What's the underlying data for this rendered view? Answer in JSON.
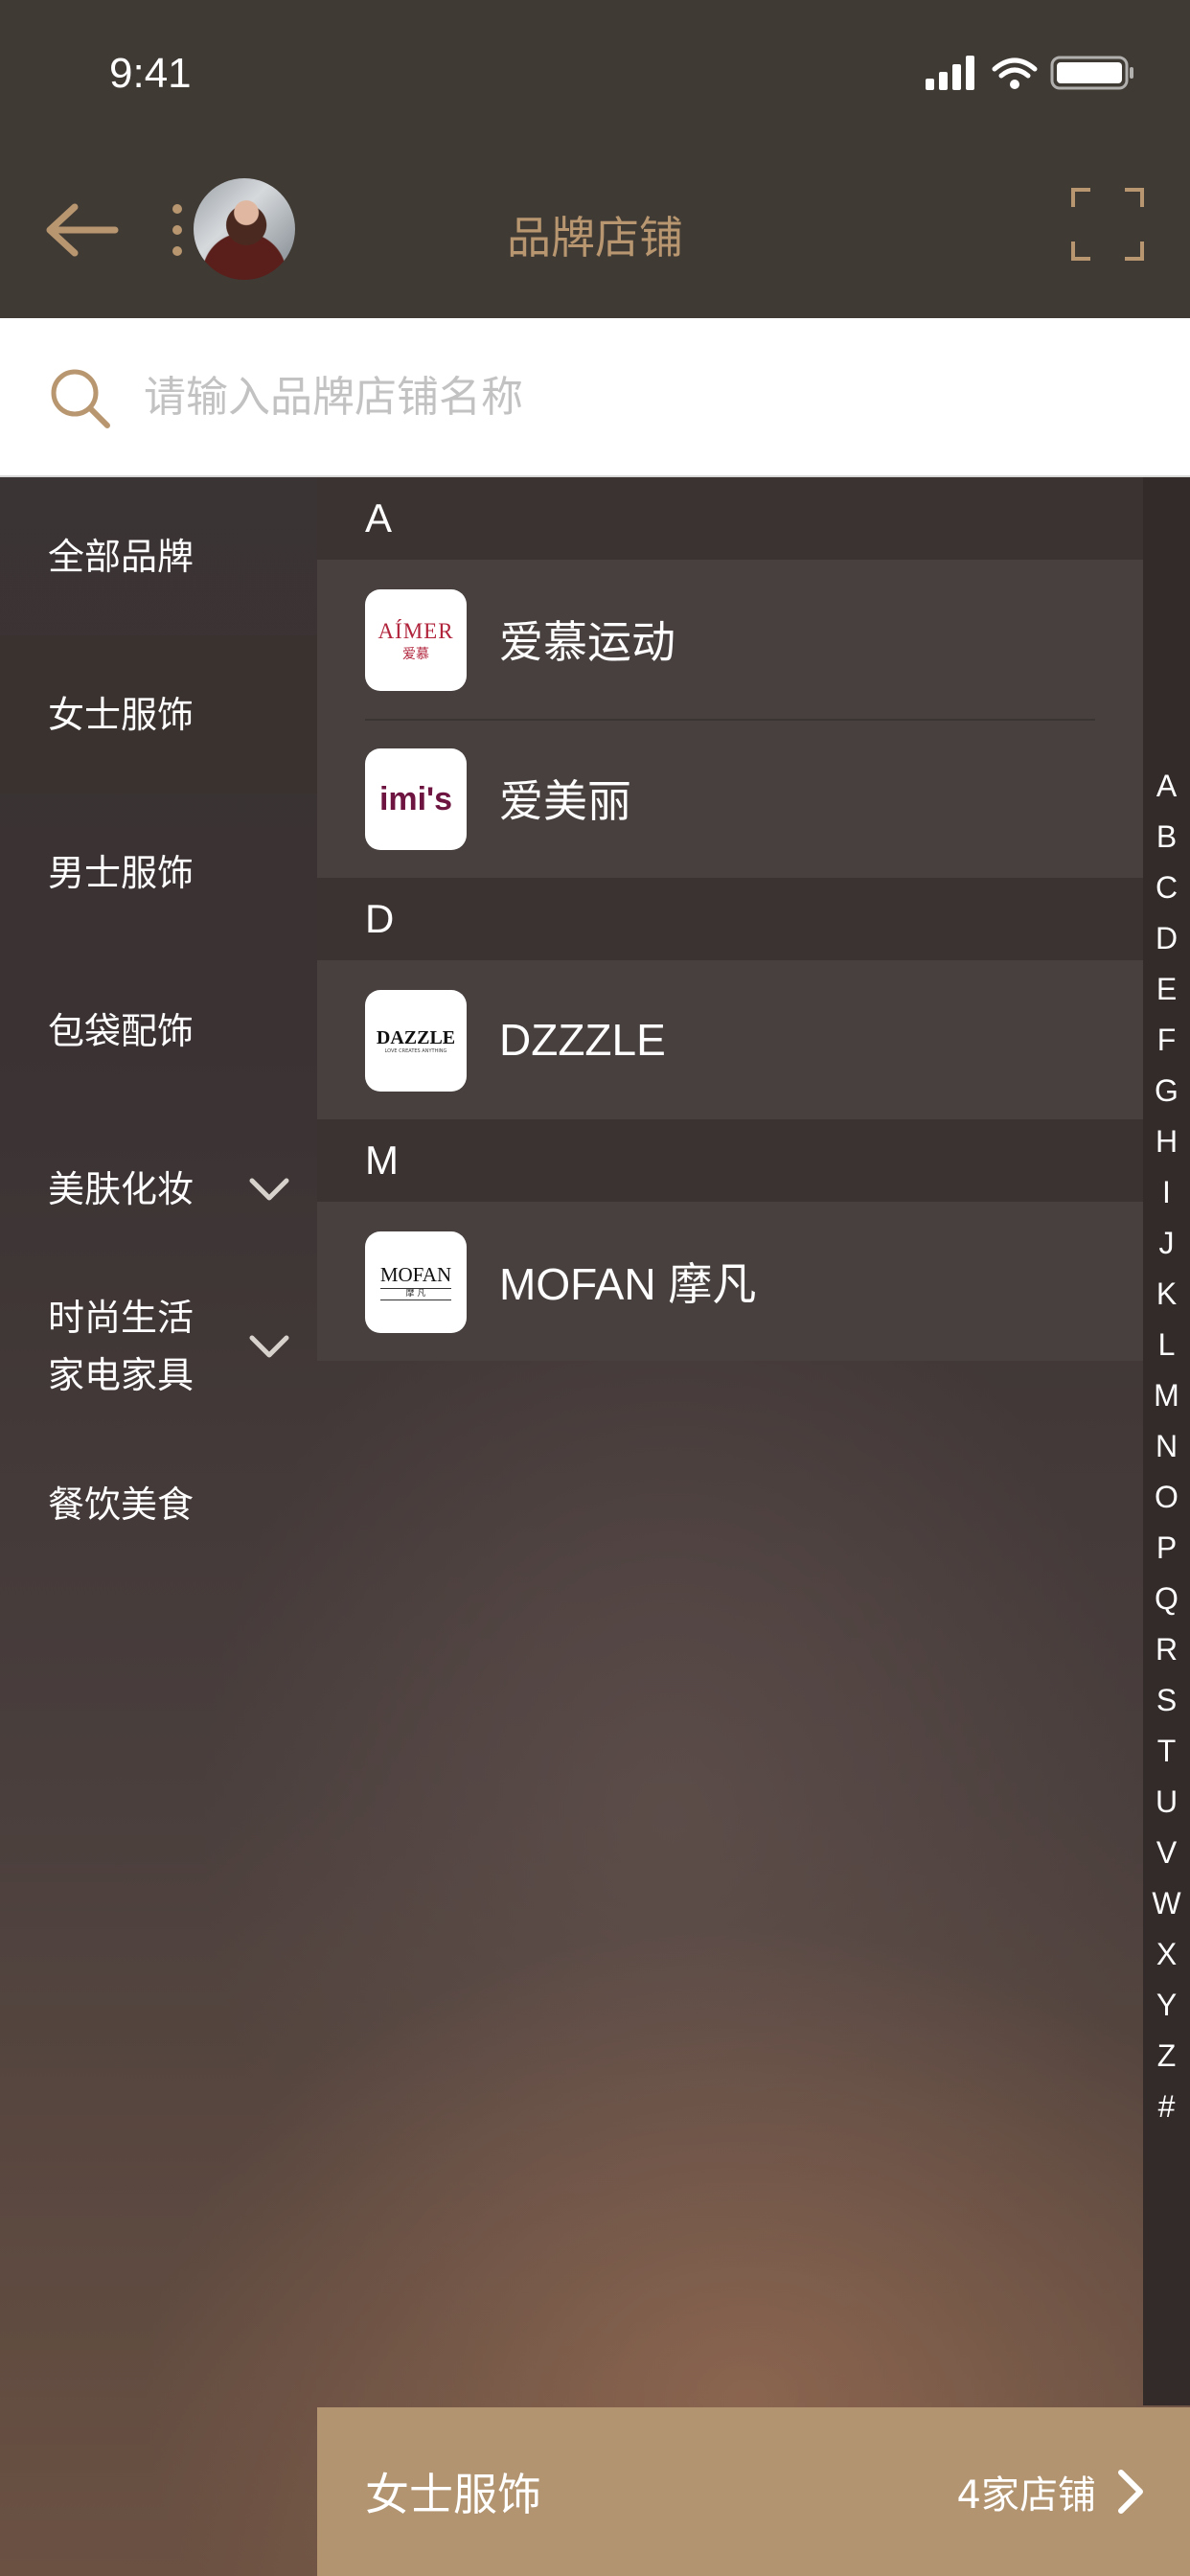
{
  "status_bar": {
    "time": "9:41"
  },
  "header": {
    "title": "品牌店铺"
  },
  "search": {
    "placeholder": "请输入品牌店铺名称"
  },
  "sidebar": {
    "items": [
      {
        "label": "全部品牌",
        "active": false,
        "expandable": false
      },
      {
        "label": "女士服饰",
        "active": true,
        "expandable": false
      },
      {
        "label": "男士服饰",
        "active": false,
        "expandable": false
      },
      {
        "label": "包袋配饰",
        "active": false,
        "expandable": false
      },
      {
        "label": "美肤化妆",
        "active": false,
        "expandable": true
      },
      {
        "label_line1": "时尚生活",
        "label_line2": "家电家具",
        "active": false,
        "expandable": true
      },
      {
        "label": "餐饮美食",
        "active": false,
        "expandable": false
      }
    ]
  },
  "sections": [
    {
      "letter": "A",
      "stores": [
        {
          "name": "爱慕运动",
          "logo_text": "AÍMER",
          "logo_sub": "爱慕"
        },
        {
          "name": "爱美丽",
          "logo_text": "imi's"
        }
      ]
    },
    {
      "letter": "D",
      "stores": [
        {
          "name": "DZZZLE",
          "logo_text": "DAZZLE",
          "logo_sub": "LOVE CREATES ANYTHING"
        }
      ]
    },
    {
      "letter": "M",
      "stores": [
        {
          "name": "MOFAN 摩凡",
          "logo_text": "MOFAN",
          "logo_sub": "摩 凡"
        }
      ]
    }
  ],
  "index_letters": [
    "A",
    "B",
    "C",
    "D",
    "E",
    "F",
    "G",
    "H",
    "I",
    "J",
    "K",
    "L",
    "M",
    "N",
    "O",
    "P",
    "Q",
    "R",
    "S",
    "T",
    "U",
    "V",
    "W",
    "X",
    "Y",
    "Z",
    "#"
  ],
  "bottom_bar": {
    "category": "女士服饰",
    "count": "4家店铺"
  },
  "colors": {
    "accent": "#b89770",
    "bottom_bar": "#b29470",
    "header": "#403a35"
  },
  "icons": [
    "back-arrow-icon",
    "more-dots-icon",
    "scan-icon",
    "search-icon",
    "chevron-down-icon",
    "chevron-right-icon"
  ]
}
